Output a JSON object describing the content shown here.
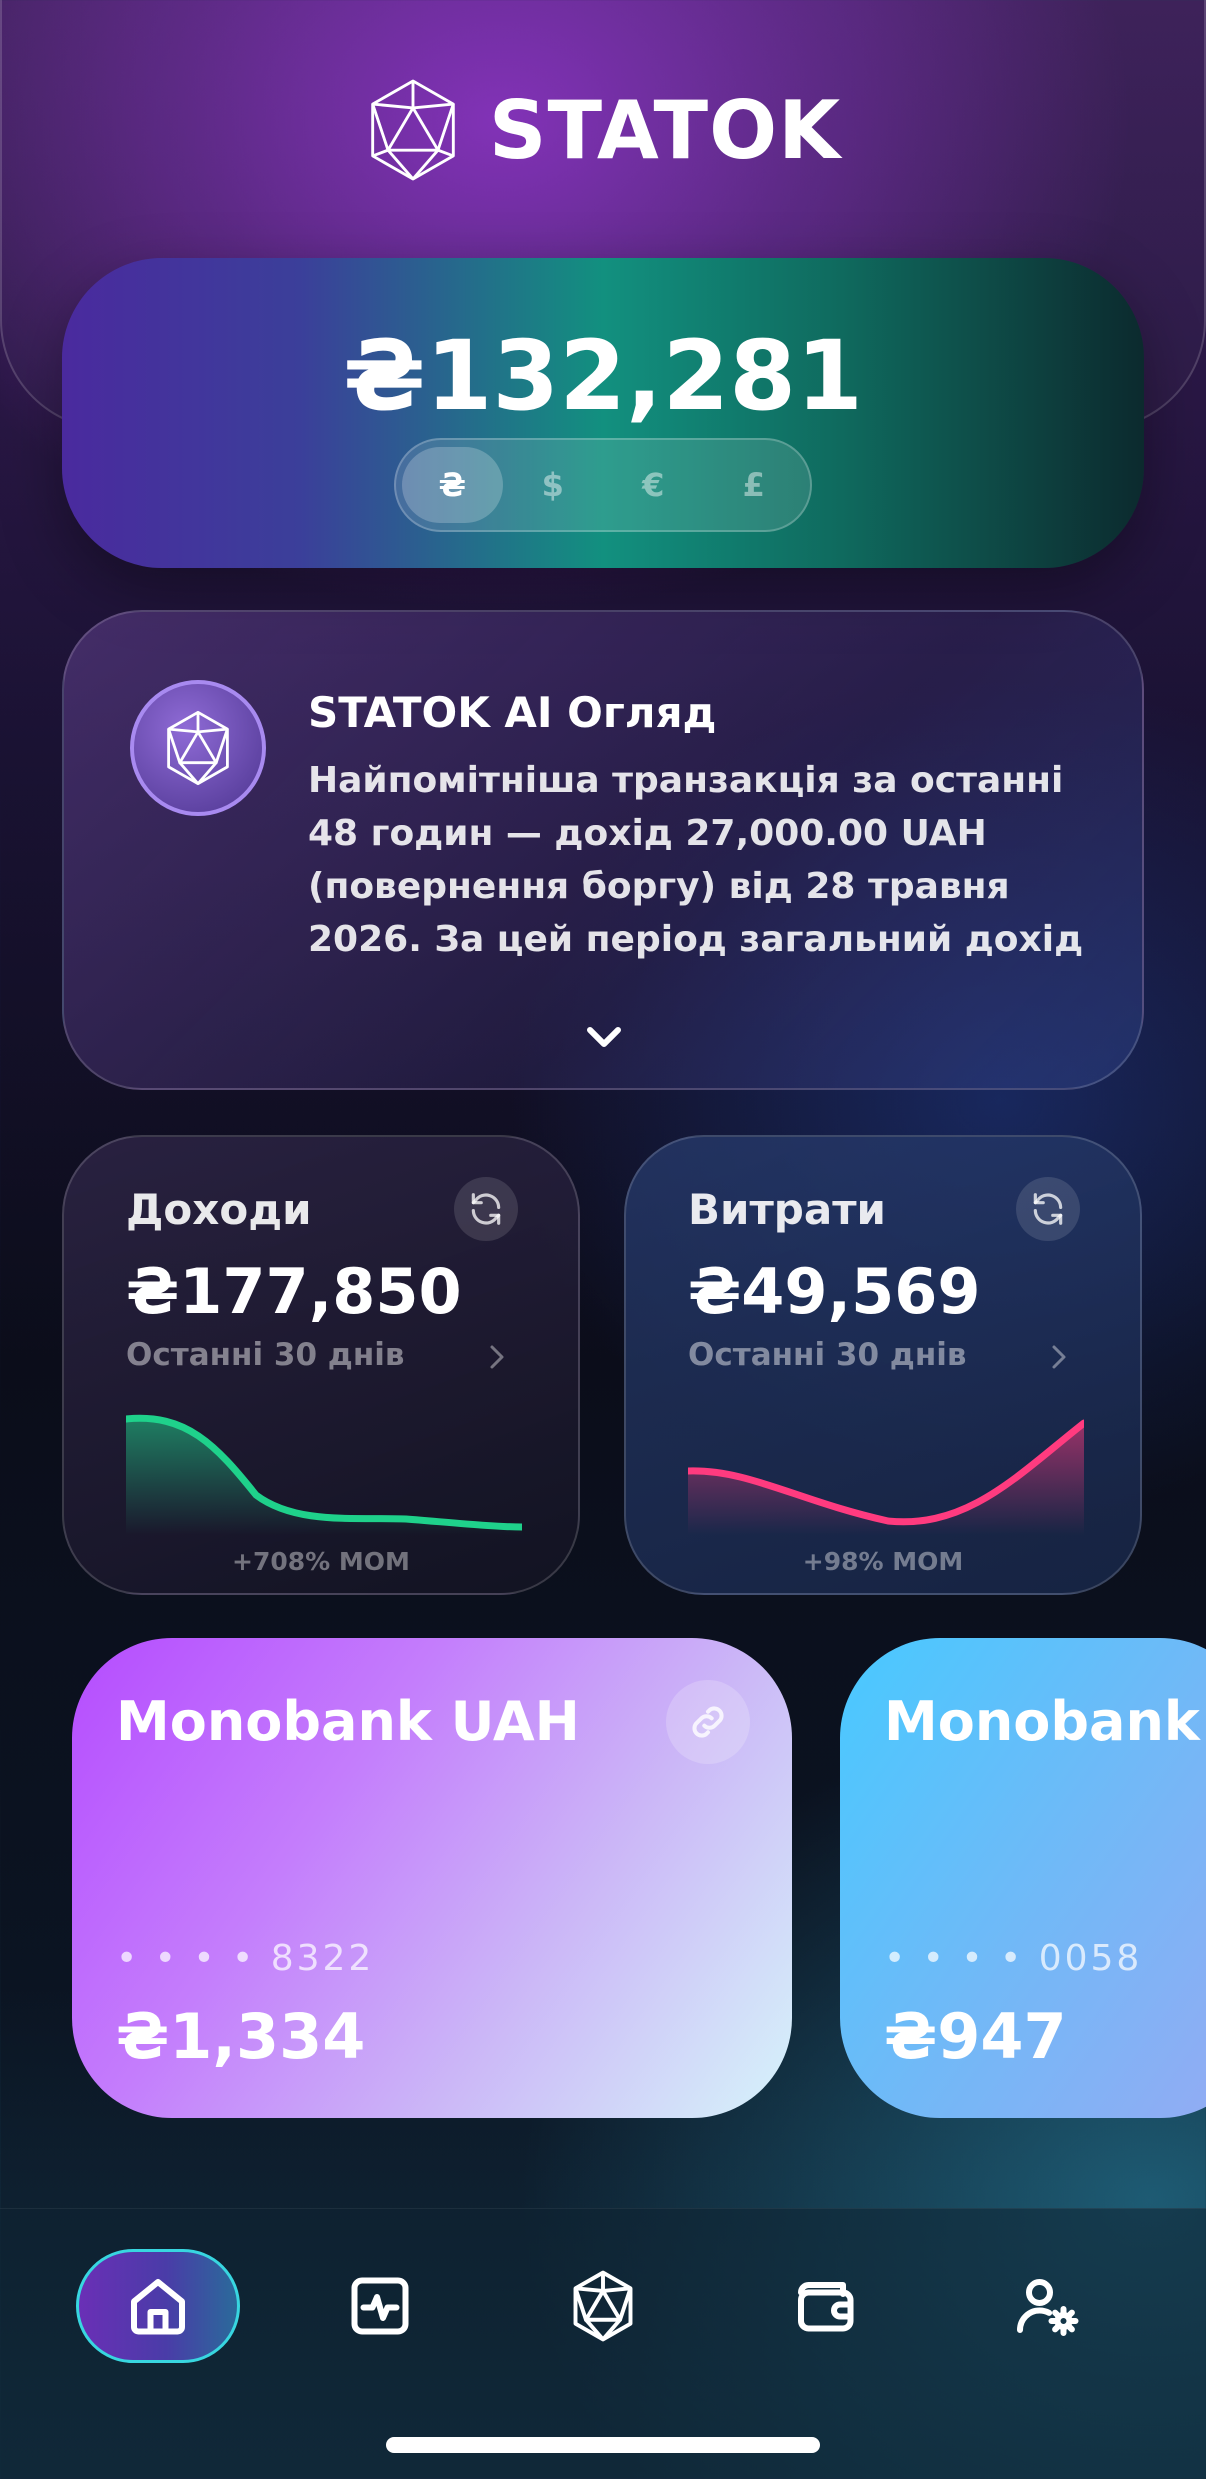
{
  "app": {
    "brand_name": "STATOK"
  },
  "balance": {
    "total": "₴132,281",
    "currencies": [
      {
        "symbol": "₴",
        "active": true
      },
      {
        "symbol": "$",
        "active": false
      },
      {
        "symbol": "€",
        "active": false
      },
      {
        "symbol": "£",
        "active": false
      }
    ]
  },
  "ai_overview": {
    "title": "STATOK AI Огляд",
    "text": "Найпомітніша транзакція за останні 48 годин — дохід 27,000.00 UAH (повернення боргу) від 28 травня 2026. За цей період загальний дохід"
  },
  "income": {
    "label": "Доходи",
    "value": "₴177,850",
    "period": "Останні 30 днів",
    "mom": "+708% MOM",
    "color": "#1fd18b"
  },
  "expenses": {
    "label": "Витрати",
    "value": "₴49,569",
    "period": "Останні 30 днів",
    "mom": "+98% MOM",
    "color": "#ff3b7f"
  },
  "accounts": [
    {
      "name": "Monobank UAH",
      "number": "• • • •  8322",
      "balance": "₴1,334",
      "icon": "link-icon"
    },
    {
      "name": "Monobank",
      "number": "• • • •  0058",
      "balance": "₴947"
    }
  ],
  "nav": [
    {
      "icon": "home-icon",
      "active": true
    },
    {
      "icon": "activity-icon",
      "active": false
    },
    {
      "icon": "ai-icosahedron-icon",
      "active": false
    },
    {
      "icon": "wallet-icon",
      "active": false
    },
    {
      "icon": "user-settings-icon",
      "active": false
    }
  ]
}
